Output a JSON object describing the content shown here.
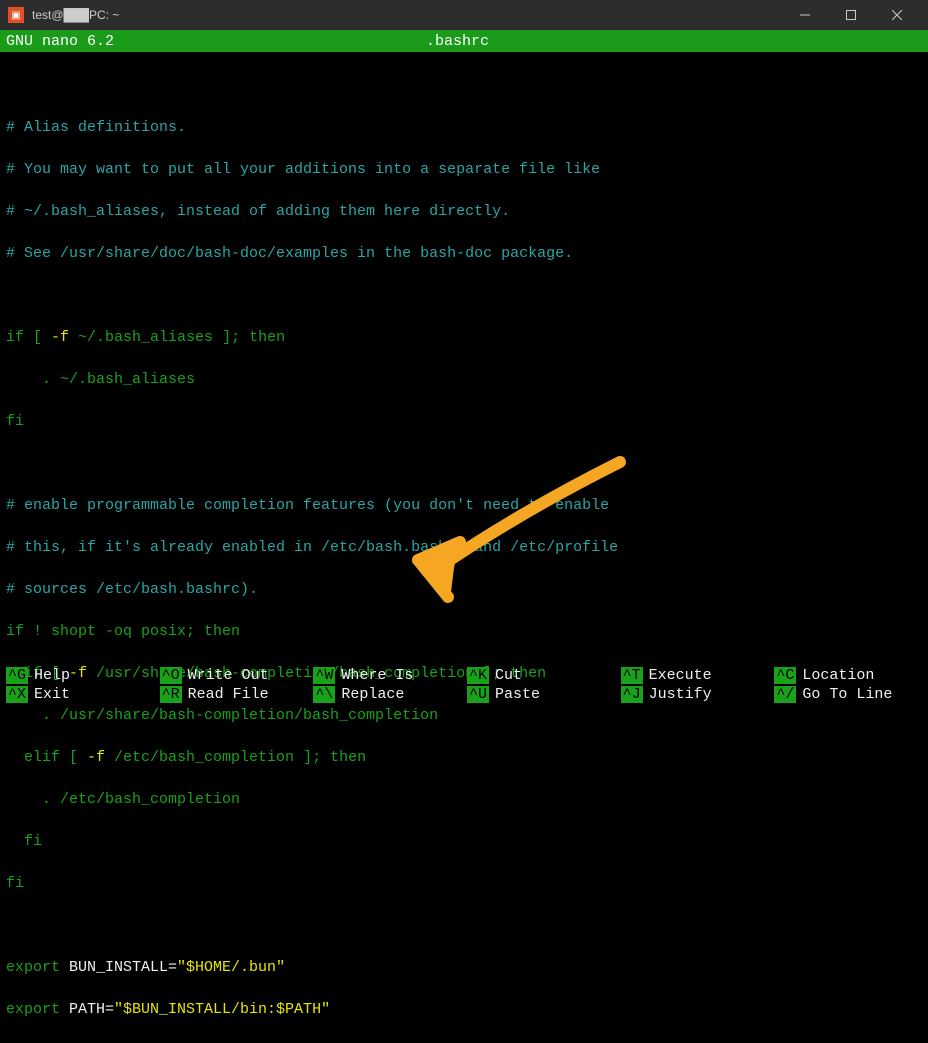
{
  "window": {
    "title": "test@███PC: ~"
  },
  "nano": {
    "app": "GNU nano 6.2",
    "filename": ".bashrc"
  },
  "code": {
    "l1": "# Alias definitions.",
    "l2": "# You may want to put all your additions into a separate file like",
    "l3": "# ~/.bash_aliases, instead of adding them here directly.",
    "l4": "# See /usr/share/doc/bash-doc/examples in the bash-doc package.",
    "l5a": "if [ ",
    "l5b": "-f",
    "l5c": " ~/.bash_aliases ",
    "l5d": "]; then",
    "l6": "    . ~/.bash_aliases",
    "l7": "fi",
    "l8": "# enable programmable completion features (you don't need to enable",
    "l9": "# this, if it's already enabled in /etc/bash.bashrc and /etc/profile",
    "l10": "# sources /etc/bash.bashrc).",
    "l11a": "if ",
    "l11b": "! shopt",
    "l11c": " -oq posix",
    "l11d": "; then",
    "l12a": "  if [ ",
    "l12b": "-f",
    "l12c": " /usr/share/bash-completion/bash_completion ",
    "l12d": "]; then",
    "l13": "    . /usr/share/bash-completion/bash_completion",
    "l14a": "  elif [ ",
    "l14b": "-f",
    "l14c": " /etc/bash_completion ",
    "l14d": "]; then",
    "l15": "    . /etc/bash_completion",
    "l16": "  fi",
    "l17": "fi",
    "l18a": "export",
    "l18b": " BUN_INSTALL=",
    "l18c": "\"$HOME/.bun\"",
    "l19a": "export",
    "l19b": " PATH=",
    "l19c": "\"$BUN_INSTALL/bin:$PATH\""
  },
  "shortcuts": [
    {
      "key": "^G",
      "label": "Help"
    },
    {
      "key": "^O",
      "label": "Write Out"
    },
    {
      "key": "^W",
      "label": "Where Is"
    },
    {
      "key": "^K",
      "label": "Cut"
    },
    {
      "key": "^T",
      "label": "Execute"
    },
    {
      "key": "^C",
      "label": "Location"
    },
    {
      "key": "^X",
      "label": "Exit"
    },
    {
      "key": "^R",
      "label": "Read File"
    },
    {
      "key": "^\\",
      "label": "Replace"
    },
    {
      "key": "^U",
      "label": "Paste"
    },
    {
      "key": "^J",
      "label": "Justify"
    },
    {
      "key": "^/",
      "label": "Go To Line"
    }
  ]
}
